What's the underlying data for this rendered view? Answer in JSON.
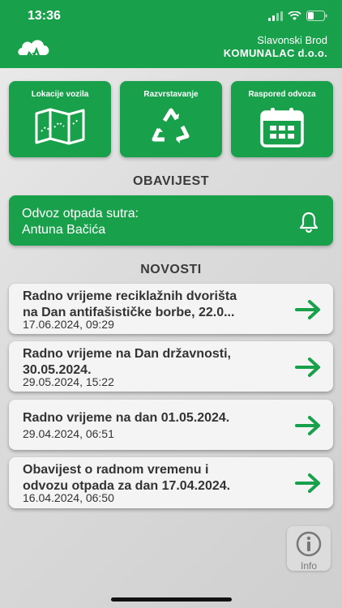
{
  "status_bar": {
    "time": "13:36"
  },
  "header": {
    "city": "Slavonski Brod",
    "company": "KOMUNALAC d.o.o."
  },
  "tiles": [
    {
      "label": "Lokacije vozila",
      "icon": "map-icon"
    },
    {
      "label": "Razvrstavanje",
      "icon": "recycle-icon"
    },
    {
      "label": "Raspored odvoza",
      "icon": "calendar-icon"
    }
  ],
  "notice_section": {
    "title": "OBAVIJEST",
    "line1": "Odvoz otpada sutra:",
    "line2": "Antuna Bačića"
  },
  "news_section": {
    "title": "NOVOSTI",
    "items": [
      {
        "title": "Radno vrijeme reciklažnih dvorišta\nna Dan antifašističke borbe, 22.0...",
        "date": "17.06.2024, 09:29"
      },
      {
        "title": "Radno vrijeme na Dan državnosti,\n30.05.2024.",
        "date": "29.05.2024, 15:22"
      },
      {
        "title": "Radno vrijeme na dan 01.05.2024.",
        "date": "29.04.2024, 06:51"
      },
      {
        "title": "Obavijest o radnom vremenu i\nodvozu otpada za dan 17.04.2024.",
        "date": "16.04.2024, 06:50"
      }
    ]
  },
  "info_button": {
    "label": "Info"
  },
  "colors": {
    "brand_green": "#18a04a",
    "card_bg": "#f4f4f4"
  }
}
